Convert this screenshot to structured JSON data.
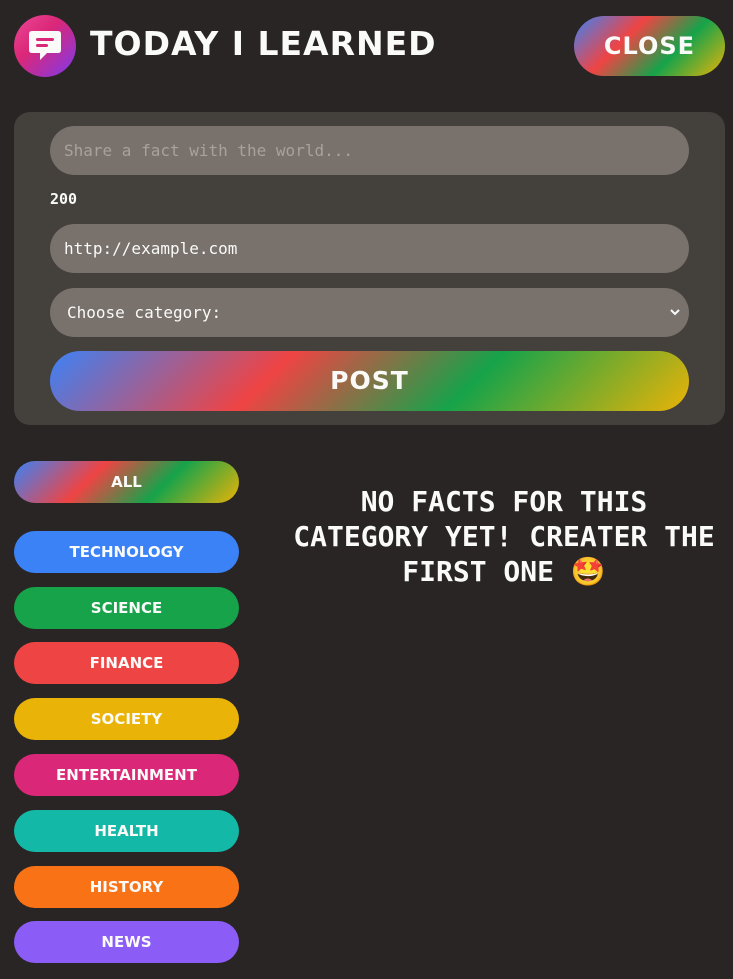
{
  "header": {
    "title": "Today I Learned",
    "close_label": "Close"
  },
  "form": {
    "fact_placeholder": "Share a fact with the world...",
    "char_count": "200",
    "source_value": "http://example.com",
    "category_select": "Choose category:",
    "post_label": "Post"
  },
  "categories": {
    "all_label": "All",
    "items": [
      {
        "label": "Technology",
        "color": "#3b82f6"
      },
      {
        "label": "Science",
        "color": "#16a34a"
      },
      {
        "label": "Finance",
        "color": "#ef4444"
      },
      {
        "label": "Society",
        "color": "#eab308"
      },
      {
        "label": "Entertainment",
        "color": "#db2777"
      },
      {
        "label": "Health",
        "color": "#14b8a6"
      },
      {
        "label": "History",
        "color": "#f97316"
      },
      {
        "label": "News",
        "color": "#8b5cf6"
      }
    ]
  },
  "main": {
    "empty_message": "No facts for this category yet! Creater the first one 🤩"
  }
}
